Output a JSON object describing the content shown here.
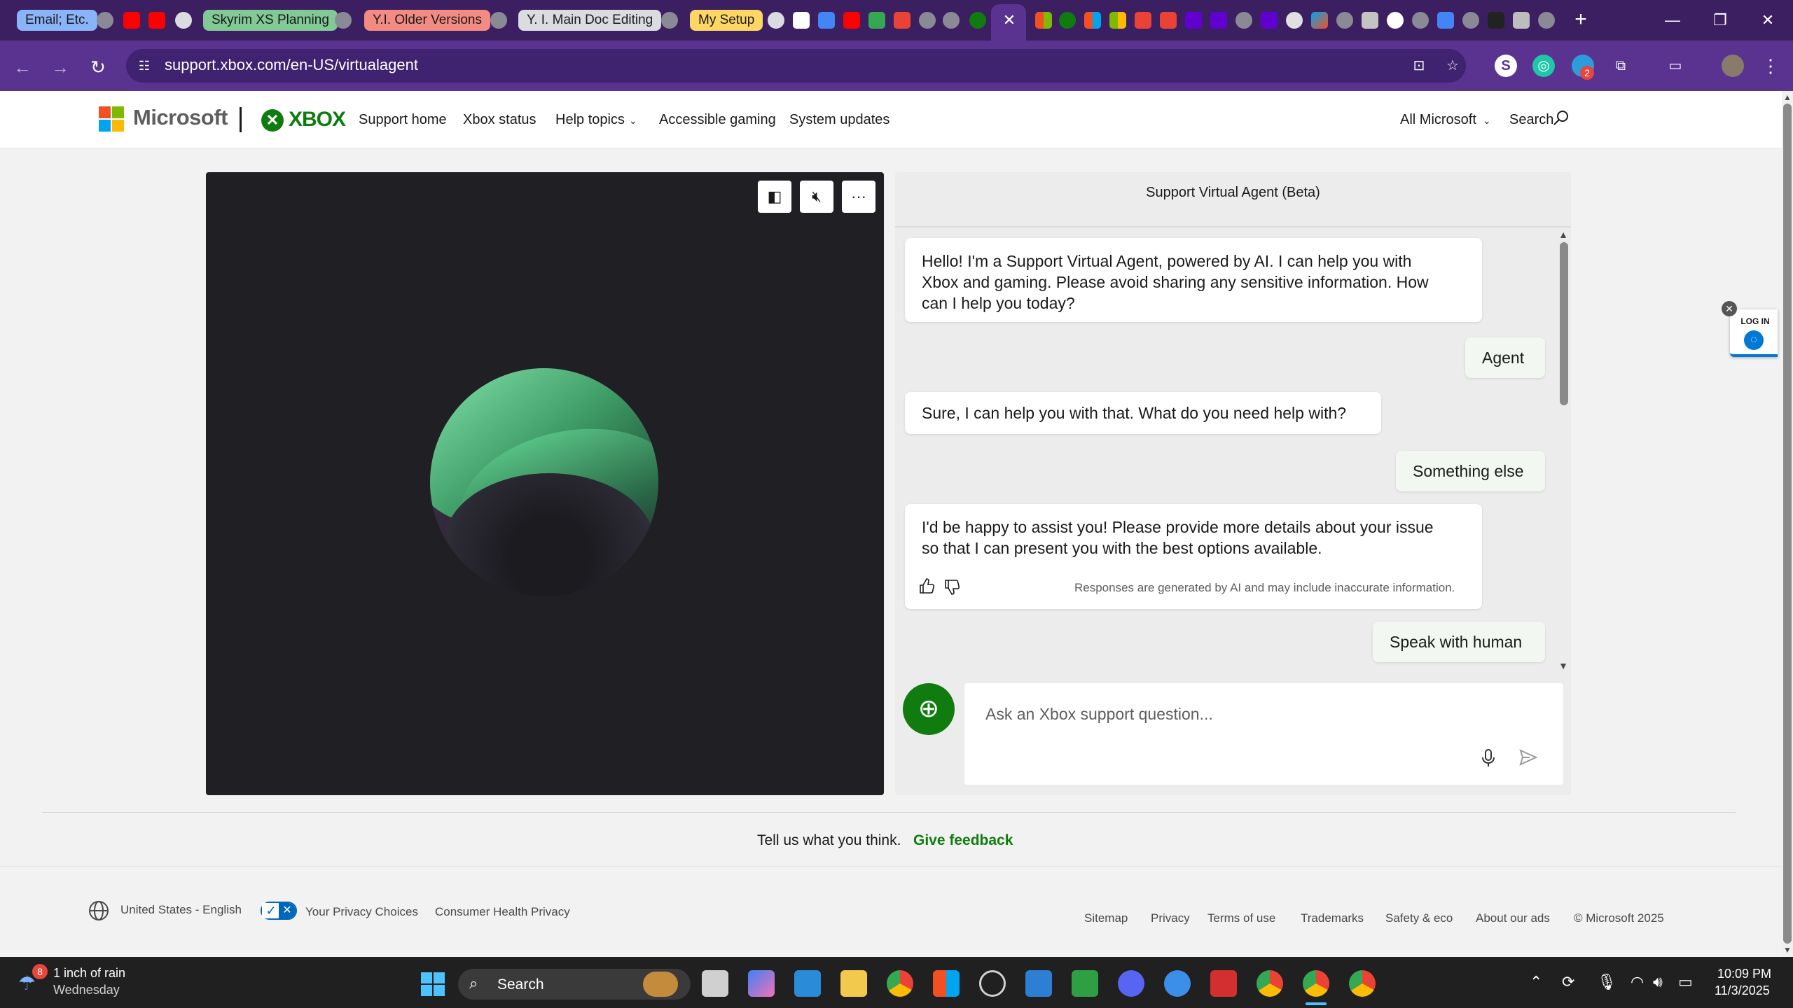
{
  "browser": {
    "tab_groups": [
      {
        "label": "Email; Etc.",
        "color": "#8ab4f8"
      },
      {
        "label": "Skyrim XS Planning",
        "color": "#81c995"
      },
      {
        "label": "Y.I. Older Versions",
        "color": "#f28b82"
      },
      {
        "label": "Y. I. Main Doc Editing",
        "color": "#dadce0"
      },
      {
        "label": "My Setup",
        "color": "#fdd663"
      }
    ],
    "active_tab_close": "✕",
    "new_tab": "+",
    "url": "support.xbox.com/en-US/virtualagent",
    "extension_badge": "2"
  },
  "site": {
    "brand": "Microsoft",
    "product": "XBOX",
    "nav": [
      "Support home",
      "Xbox status",
      "Help topics",
      "Accessible gaming",
      "System updates"
    ],
    "all_microsoft": "All Microsoft",
    "search": "Search"
  },
  "agent": {
    "title": "Support Virtual Agent (Beta)",
    "messages": [
      {
        "from": "bot",
        "lines": [
          "Hello! I'm a Support Virtual Agent, powered by AI. I can help you with",
          "Xbox and gaming. Please avoid sharing any sensitive information. How",
          "can I help you today?"
        ]
      },
      {
        "from": "user",
        "text": "Agent"
      },
      {
        "from": "bot",
        "lines": [
          "Sure, I can help you with that. What do you need help with?"
        ]
      },
      {
        "from": "user",
        "text": "Something else"
      },
      {
        "from": "bot",
        "lines": [
          "I'd be happy to assist you! Please provide more details about your issue",
          "so that I can present you with the best options available."
        ]
      },
      {
        "from": "user",
        "text": "Speak with human"
      }
    ],
    "disclaimer": "Responses are generated by AI and may include inaccurate information.",
    "input_placeholder": "Ask an Xbox support question...",
    "login_label": "LOG IN"
  },
  "feedback": {
    "prompt": "Tell us what you think.",
    "link": "Give feedback"
  },
  "footer": {
    "locale": "United States - English",
    "privacy_choices": "Your Privacy Choices",
    "health_privacy": "Consumer Health Privacy",
    "links": [
      "Sitemap",
      "Privacy",
      "Terms of use",
      "Trademarks",
      "Safety & eco",
      "About our ads"
    ],
    "copyright": "© Microsoft 2025"
  },
  "taskbar": {
    "weather_badge": "8",
    "weather_title": "1 inch of rain",
    "weather_sub": "Wednesday",
    "search": "Search",
    "time": "10:09 PM",
    "date": "11/3/2025"
  },
  "colors": {
    "xbox_green": "#107c10",
    "titlebar": "#3c1f61",
    "toolbar": "#5a3391"
  }
}
